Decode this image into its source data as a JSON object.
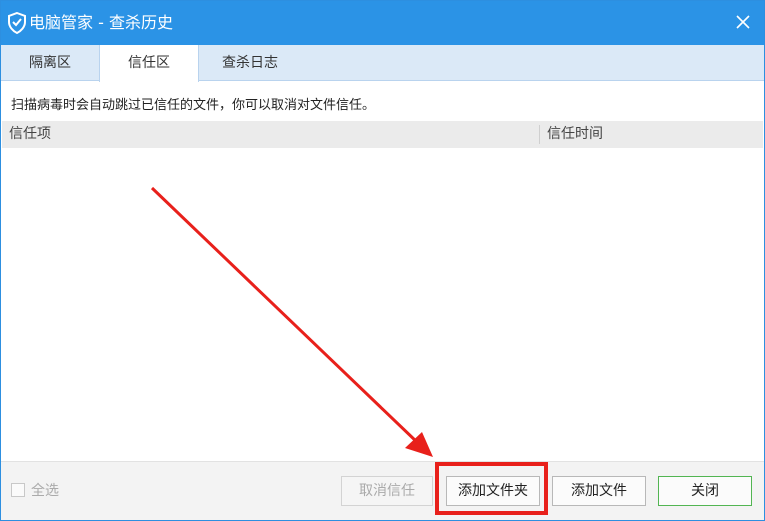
{
  "window": {
    "title": "电脑管家 - 查杀历史",
    "accent_color": "#2b93e6"
  },
  "tabs": [
    {
      "label": "隔离区",
      "active": false
    },
    {
      "label": "信任区",
      "active": true
    },
    {
      "label": "查杀日志",
      "active": false
    }
  ],
  "notice": "扫描病毒时会自动跳过已信任的文件，你可以取消对文件信任。",
  "table": {
    "columns": [
      "信任项",
      "信任时间"
    ],
    "rows": []
  },
  "footer": {
    "select_all": "全选",
    "buttons": {
      "cancel_trust": "取消信任",
      "add_folder": "添加文件夹",
      "add_file": "添加文件",
      "close": "关闭"
    }
  },
  "annotation": {
    "highlight_color": "#e8201b",
    "target": "add_folder"
  }
}
